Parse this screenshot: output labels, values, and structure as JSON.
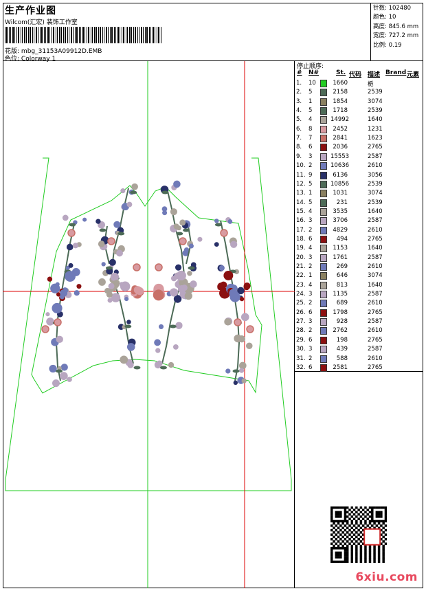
{
  "header": {
    "title": "生产作业图",
    "subtitle": "Wilcom(汇宏) 装饰工作室",
    "design_label": "花版:",
    "design_name": "mbg_31153A09912D.EMB",
    "colorway_label": "色位:",
    "colorway_name": "Colorway 1"
  },
  "stats": [
    {
      "label": "针数:",
      "value": "102480"
    },
    {
      "label": "颜色:",
      "value": "10"
    },
    {
      "label": "高度:",
      "value": "845.6 mm"
    },
    {
      "label": "宽度:",
      "value": "727.2 mm"
    },
    {
      "label": "比例:",
      "value": "0.19"
    }
  ],
  "sequence": {
    "title": "停止顺序:",
    "headers": {
      "num": "#",
      "n": "N#",
      "stitches": "St.",
      "code": "代码",
      "desc": "描述",
      "brand": "Brand",
      "element": "元素"
    },
    "rows": [
      {
        "num": "1.",
        "n": "10",
        "color": "#22cc22",
        "st": "1660",
        "code": "栀"
      },
      {
        "num": "2.",
        "n": "5",
        "color": "#4d6b57",
        "st": "2158",
        "code": "2539"
      },
      {
        "num": "3.",
        "n": "1",
        "color": "#8a8060",
        "st": "1854",
        "code": "3074"
      },
      {
        "num": "4.",
        "n": "5",
        "color": "#4d6b57",
        "st": "1718",
        "code": "2539"
      },
      {
        "num": "5.",
        "n": "4",
        "color": "#aaa399",
        "st": "14992",
        "code": "1640"
      },
      {
        "num": "6.",
        "n": "8",
        "color": "#d89aa0",
        "st": "2452",
        "code": "1231"
      },
      {
        "num": "7.",
        "n": "7",
        "color": "#c87068",
        "st": "2841",
        "code": "1623"
      },
      {
        "num": "8.",
        "n": "6",
        "color": "#8b1010",
        "st": "2036",
        "code": "2765"
      },
      {
        "num": "9.",
        "n": "3",
        "color": "#b8a6c0",
        "st": "15553",
        "code": "2587"
      },
      {
        "num": "10.",
        "n": "2",
        "color": "#6f7ab8",
        "st": "10636",
        "code": "2610"
      },
      {
        "num": "11.",
        "n": "9",
        "color": "#283068",
        "st": "6136",
        "code": "3056"
      },
      {
        "num": "12.",
        "n": "5",
        "color": "#4d6b57",
        "st": "10856",
        "code": "2539"
      },
      {
        "num": "13.",
        "n": "1",
        "color": "#8a8060",
        "st": "1031",
        "code": "3074"
      },
      {
        "num": "14.",
        "n": "5",
        "color": "#4d6b57",
        "st": "231",
        "code": "2539"
      },
      {
        "num": "15.",
        "n": "4",
        "color": "#aaa399",
        "st": "3535",
        "code": "1640"
      },
      {
        "num": "16.",
        "n": "3",
        "color": "#b8a6c0",
        "st": "3706",
        "code": "2587"
      },
      {
        "num": "17.",
        "n": "2",
        "color": "#6f7ab8",
        "st": "4829",
        "code": "2610"
      },
      {
        "num": "18.",
        "n": "6",
        "color": "#8b1010",
        "st": "494",
        "code": "2765"
      },
      {
        "num": "19.",
        "n": "4",
        "color": "#aaa399",
        "st": "1153",
        "code": "1640"
      },
      {
        "num": "20.",
        "n": "3",
        "color": "#b8a6c0",
        "st": "1761",
        "code": "2587"
      },
      {
        "num": "21.",
        "n": "2",
        "color": "#6f7ab8",
        "st": "269",
        "code": "2610"
      },
      {
        "num": "22.",
        "n": "1",
        "color": "#8a8060",
        "st": "646",
        "code": "3074"
      },
      {
        "num": "23.",
        "n": "4",
        "color": "#aaa399",
        "st": "813",
        "code": "1640"
      },
      {
        "num": "24.",
        "n": "3",
        "color": "#b8a6c0",
        "st": "1135",
        "code": "2587"
      },
      {
        "num": "25.",
        "n": "2",
        "color": "#6f7ab8",
        "st": "689",
        "code": "2610"
      },
      {
        "num": "26.",
        "n": "6",
        "color": "#8b1010",
        "st": "1798",
        "code": "2765"
      },
      {
        "num": "27.",
        "n": "3",
        "color": "#b8a6c0",
        "st": "928",
        "code": "2587"
      },
      {
        "num": "28.",
        "n": "2",
        "color": "#6f7ab8",
        "st": "2762",
        "code": "2610"
      },
      {
        "num": "29.",
        "n": "6",
        "color": "#8b1010",
        "st": "198",
        "code": "2765"
      },
      {
        "num": "30.",
        "n": "3",
        "color": "#b8a6c0",
        "st": "439",
        "code": "2587"
      },
      {
        "num": "31.",
        "n": "2",
        "color": "#6f7ab8",
        "st": "588",
        "code": "2610"
      },
      {
        "num": "32.",
        "n": "6",
        "color": "#8b1010",
        "st": "2581",
        "code": "2765"
      }
    ]
  },
  "watermark": "6xiu.com",
  "colors": {
    "outline": "#22cc22",
    "crosshair": "#dd0000"
  }
}
